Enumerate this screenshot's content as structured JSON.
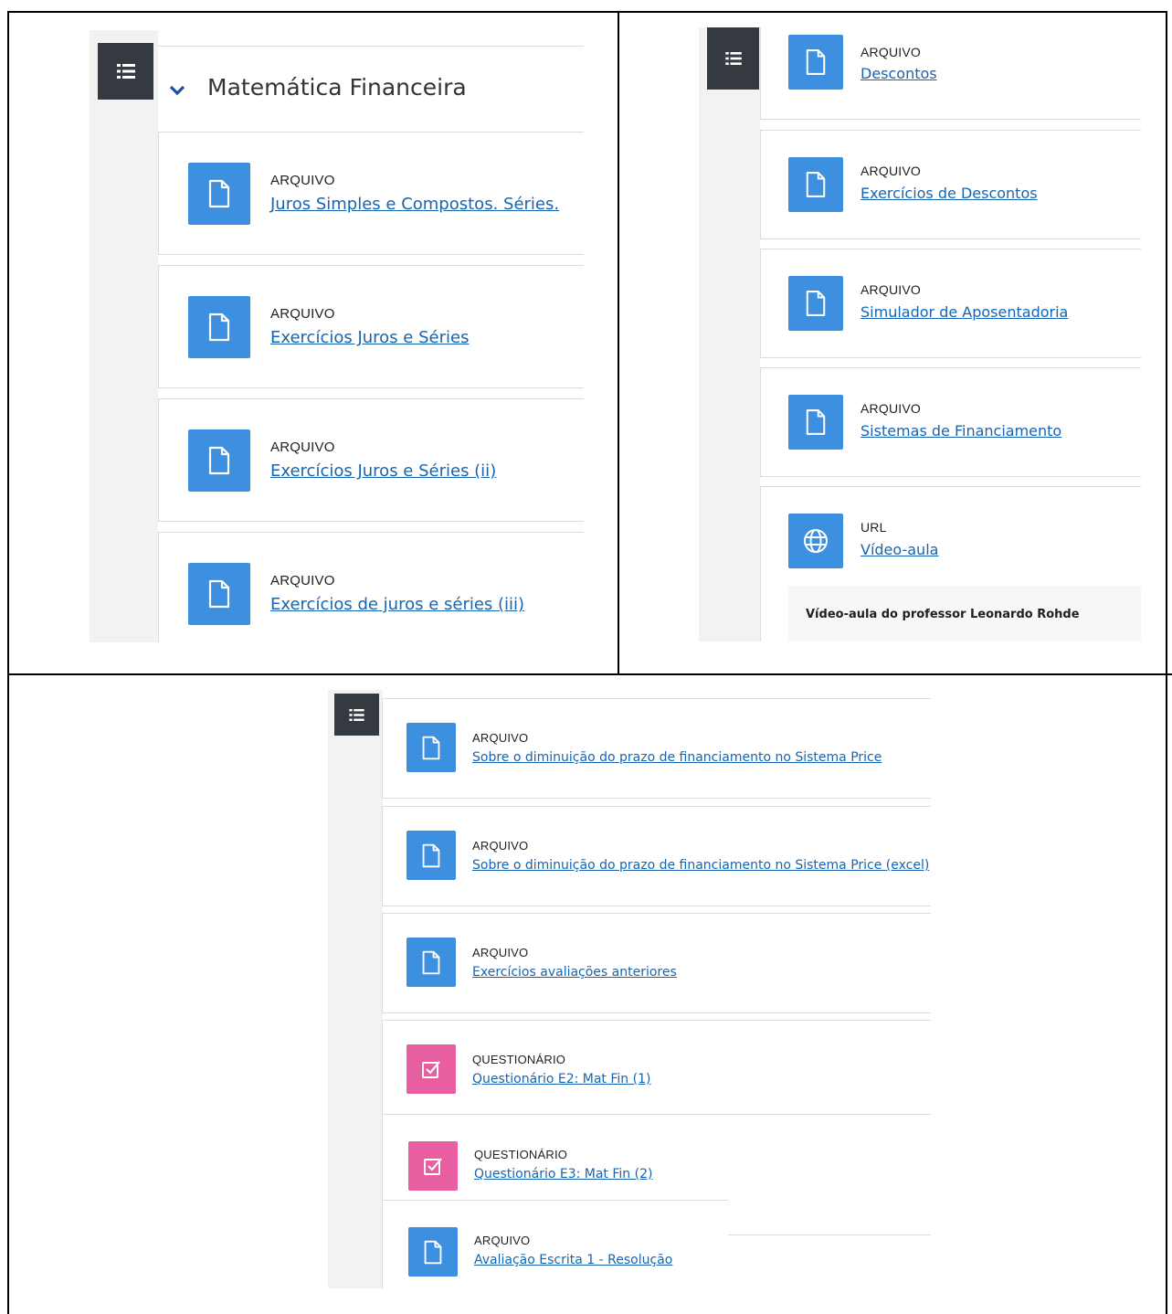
{
  "section": {
    "title": "Matemática Financeira"
  },
  "panel1": {
    "items": [
      {
        "type": "ARQUIVO",
        "title": "Juros Simples e Compostos. Séries.",
        "icon": "file-icon"
      },
      {
        "type": "ARQUIVO",
        "title": "Exercícios Juros e Séries",
        "icon": "file-icon"
      },
      {
        "type": "ARQUIVO",
        "title": "Exercícios Juros e Séries (ii)",
        "icon": "file-icon"
      },
      {
        "type": "ARQUIVO",
        "title": "Exercícios de juros e séries (iii)",
        "icon": "file-icon"
      }
    ]
  },
  "panel2": {
    "items": [
      {
        "type": "ARQUIVO",
        "title": "Descontos",
        "icon": "file-icon"
      },
      {
        "type": "ARQUIVO",
        "title": "Exercícios de Descontos",
        "icon": "file-icon"
      },
      {
        "type": "ARQUIVO",
        "title": "Simulador de Aposentadoria",
        "icon": "file-icon"
      },
      {
        "type": "ARQUIVO",
        "title": "Sistemas de Financiamento",
        "icon": "file-icon"
      },
      {
        "type": "URL",
        "title": "Vídeo-aula",
        "icon": "globe-icon",
        "description": "Vídeo-aula do professor Leonardo Rohde"
      }
    ]
  },
  "panel3": {
    "items": [
      {
        "type": "ARQUIVO",
        "title": "Sobre o diminuição do prazo de financiamento no Sistema Price",
        "icon": "file-icon"
      },
      {
        "type": "ARQUIVO",
        "title": "Sobre o diminuição do prazo de financiamento no Sistema Price (excel)",
        "icon": "file-icon"
      },
      {
        "type": "ARQUIVO",
        "title": "Exercícios avaliações anteriores",
        "icon": "file-icon"
      },
      {
        "type": "QUESTIONÁRIO",
        "title": "Questionário E2: Mat Fin (1)",
        "icon": "quiz-icon"
      },
      {
        "type": "QUESTIONÁRIO",
        "title": "Questionário E3: Mat Fin (2)",
        "icon": "quiz-icon"
      },
      {
        "type": "ARQUIVO",
        "title": "Avaliação Escrita 1 - Resolução",
        "icon": "file-icon"
      }
    ]
  },
  "colors": {
    "file_icon": "#3d8fe0",
    "quiz_icon": "#e85fa1",
    "link": "#1765b0",
    "menu_button": "#343a40",
    "chevron": "#1f4fa0"
  }
}
